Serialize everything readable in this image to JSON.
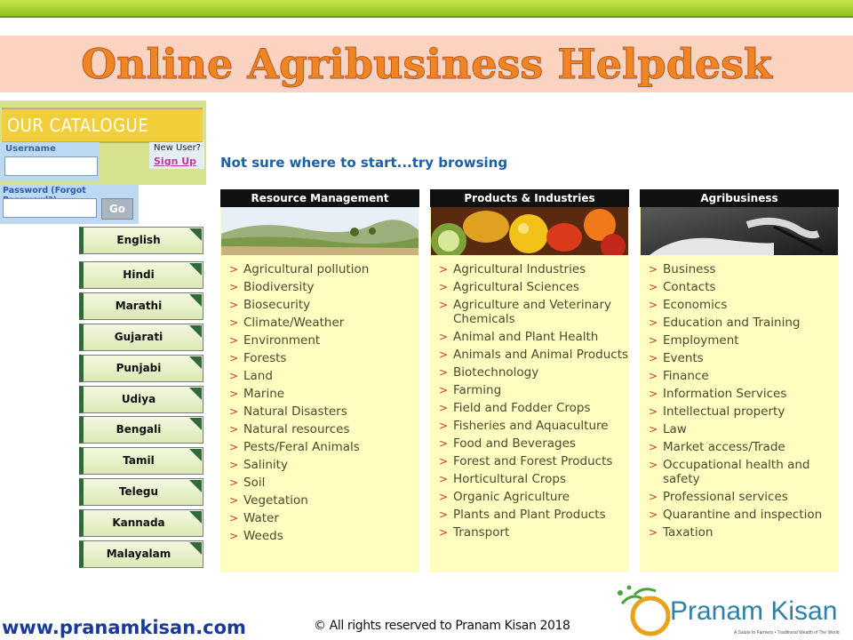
{
  "header": {
    "title": "Online Agribusiness Helpdesk"
  },
  "catalogue": {
    "title": "OUR CATALOGUE",
    "username_label": "Username",
    "username_value": "",
    "new_user": "New User?",
    "sign_up": "Sign Up",
    "password_label": "Password",
    "forgot_password": "(Forgot Password?)",
    "password_value": "",
    "go_label": "Go"
  },
  "languages": [
    "English",
    "Hindi",
    "Marathi",
    "Gujarati",
    "Punjabi",
    "Udiya",
    "Bengali",
    "Tamil",
    "Telegu",
    "Kannada",
    "Malayalam"
  ],
  "browse_heading": "Not sure where to start...try browsing",
  "categories": [
    {
      "title": "Resource Management",
      "image": "landscape-image",
      "items": [
        "Agricultural pollution",
        "Biodiversity",
        "Biosecurity",
        "Climate/Weather",
        "Environment",
        "Forests",
        "Land",
        "Marine",
        "Natural Disasters",
        "Natural resources",
        "Pests/Feral Animals",
        "Salinity",
        "Soil",
        "Vegetation",
        "Water",
        "Weeds"
      ]
    },
    {
      "title": "Products & Industries",
      "image": "produce-image",
      "items": [
        "Agricultural Industries",
        "Agricultural Sciences",
        "Agriculture and Veterinary Chemicals",
        "Animal and Plant Health",
        "Animals and Animal Products",
        "Biotechnology",
        "Farming",
        "Field and Fodder Crops",
        "Fisheries and Aquaculture",
        "Food and Beverages",
        "Forest and Forest Products",
        "Horticultural Crops",
        "Organic Agriculture",
        "Plants and Plant Products",
        "Transport"
      ]
    },
    {
      "title": "Agribusiness",
      "image": "hands-writing-image",
      "items": [
        "Business",
        "Contacts",
        "Economics",
        "Education and Training",
        "Employment",
        "Events",
        "Finance",
        "Information Services",
        "Intellectual property",
        "Law",
        "Market access/Trade",
        "Occupational health and safety",
        "Professional services",
        "Quarantine and inspection",
        "Taxation"
      ]
    }
  ],
  "footer": {
    "website": "www.pranamkisan.com",
    "copyright": "© All rights reserved to Pranam Kisan 2018",
    "logo_name": "Pranam Kisan",
    "logo_tagline": "A Salute to Farmers • Traditional Wealth of The World"
  },
  "colors": {
    "title_orange": "#f08524",
    "accent_blue": "#1d5fa8",
    "panel_yellow": "#fffec0",
    "top_green": "#8fc21e"
  }
}
